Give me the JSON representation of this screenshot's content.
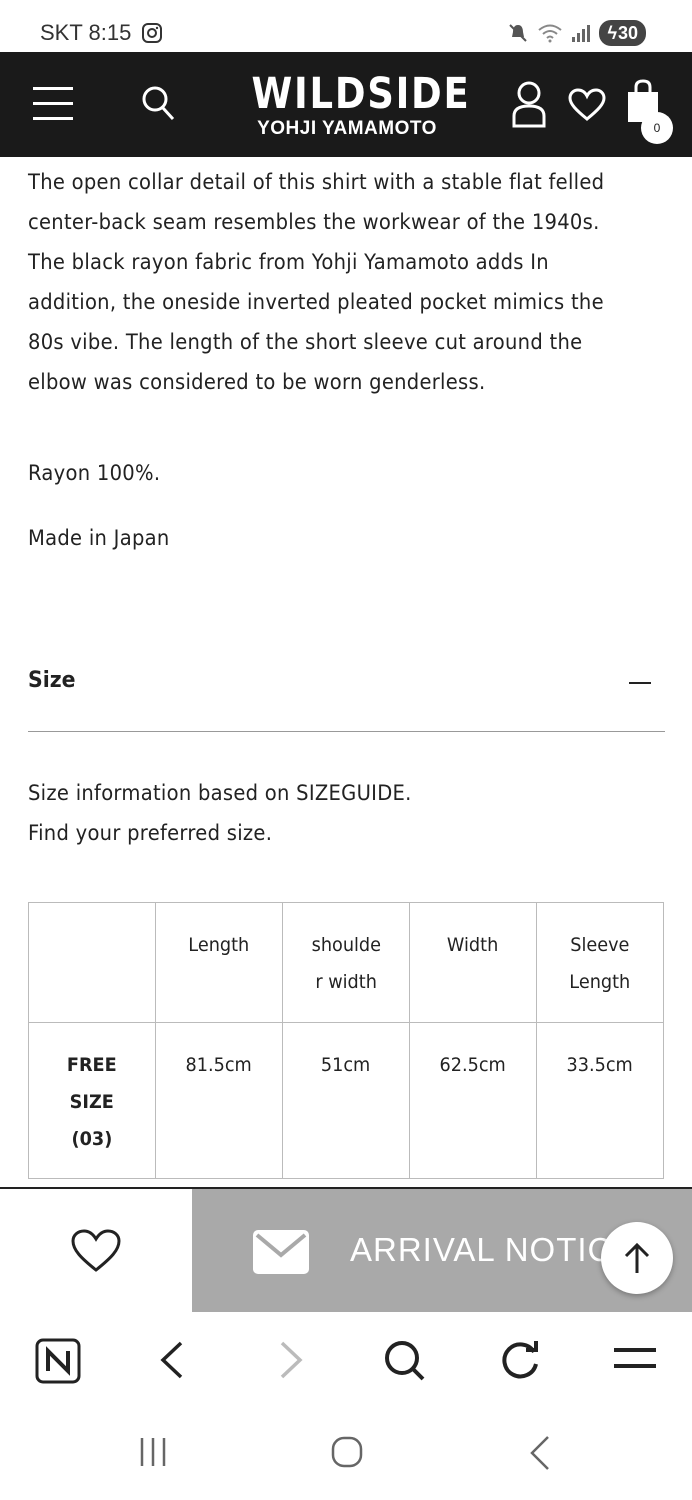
{
  "status_bar": {
    "carrier_time": "SKT 8:15",
    "battery": "30",
    "icons": [
      "instagram-icon",
      "mute-icon",
      "wifi-icon",
      "signal-icon"
    ]
  },
  "header": {
    "brand_main": "WILDSIDE",
    "brand_sub": "YOHJI YAMAMOTO",
    "cart_count": "0",
    "icons": [
      "menu-icon",
      "search-icon",
      "user-icon",
      "heart-icon",
      "bag-icon"
    ]
  },
  "description": {
    "lines": [
      "The open collar detail of this shirt with a stable flat felled",
      "center-back seam resembles the workwear of the 1940s.",
      "The black rayon fabric from Yohji Yamamoto adds In",
      "addition, the oneside inverted pleated pocket mimics the",
      "80s vibe. The length of the short sleeve cut around the",
      "elbow was considered to be worn genderless."
    ],
    "material": "Rayon 100%.",
    "origin": "Made in Japan"
  },
  "size_section": {
    "title": "Size",
    "toggle_symbol": "−",
    "info_line1": "Size information based on SIZEGUIDE.",
    "info_line2": "Find your preferred size.",
    "table": {
      "headers": [
        "",
        [
          "Length"
        ],
        [
          "shoulde",
          "r width"
        ],
        [
          "Width"
        ],
        [
          "Sleeve",
          "Length"
        ]
      ],
      "row": {
        "label": [
          "FREE",
          "SIZE",
          "(03)"
        ],
        "values": [
          "81.5cm",
          "51cm",
          "62.5cm",
          "33.5cm"
        ]
      }
    }
  },
  "action_bar": {
    "notice_label": "ARRIVAL NOTICE",
    "icons": [
      "heart-outline-icon",
      "mail-icon",
      "arrow-up-icon"
    ]
  },
  "browser_bar": {
    "icons": [
      "naver-icon",
      "back-icon",
      "forward-icon",
      "search-icon",
      "refresh-icon",
      "menu-icon"
    ]
  },
  "system_nav": {
    "icons": [
      "recents-icon",
      "home-icon",
      "back-icon"
    ]
  }
}
